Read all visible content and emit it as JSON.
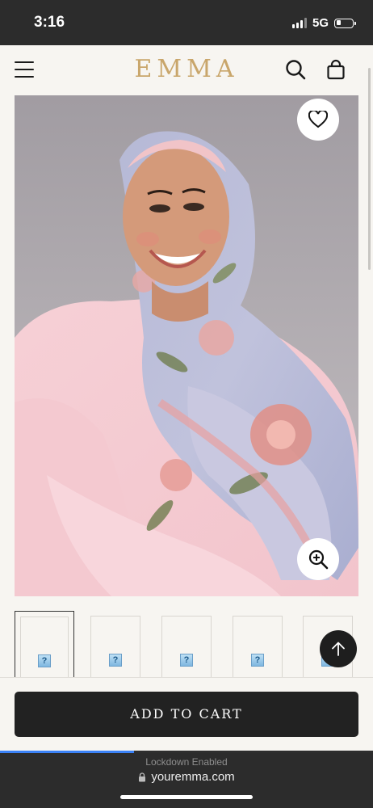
{
  "status_bar": {
    "time": "3:16",
    "network": "5G",
    "battery_level": 0.3
  },
  "header": {
    "brand": "EMMA",
    "menu_icon": "hamburger-menu-icon",
    "search_icon": "search-icon",
    "bag_icon": "shopping-bag-icon"
  },
  "product": {
    "wishlist_icon": "heart-icon",
    "zoom_icon": "zoom-in-icon",
    "thumbnails": [
      {
        "broken_label": "?"
      },
      {
        "broken_label": "?"
      },
      {
        "broken_label": "?"
      },
      {
        "broken_label": "?"
      },
      {
        "broken_label": "?"
      }
    ],
    "active_thumbnail": 0,
    "back_to_top_icon": "arrow-up-icon"
  },
  "cart": {
    "button_label": "ADD TO CART"
  },
  "browser": {
    "lockdown_text": "Lockdown Enabled",
    "url": "youremma.com",
    "lock_icon": "lock-icon",
    "load_progress": 0.36
  },
  "colors": {
    "brand_gold": "#c9a66b",
    "button_dark": "#222222",
    "page_bg": "#f7f5f1",
    "progress_blue": "#3b82f6"
  }
}
